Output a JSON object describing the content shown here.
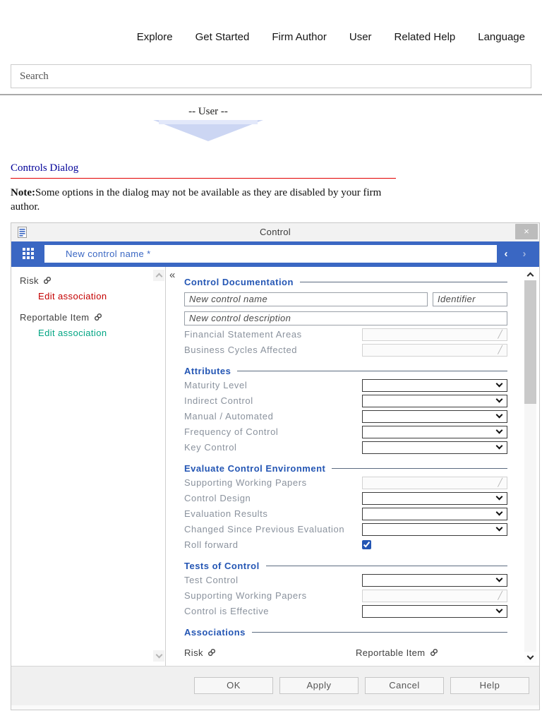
{
  "nav": {
    "items": [
      "Explore",
      "Get Started",
      "Firm Author",
      "User",
      "Related Help",
      "Language"
    ]
  },
  "search": {
    "placeholder": "Search"
  },
  "flow": {
    "user_label": "-- User --"
  },
  "article": {
    "title": "Controls Dialog",
    "note_label": "Note:",
    "note_text": "Some options in the dialog may not be available as they are disabled by your firm author."
  },
  "icons": {
    "close": "×",
    "collapse": "«",
    "prev": "‹",
    "next": "›",
    "edit": "╱"
  },
  "dialog": {
    "title": "Control",
    "toolbar": {
      "name_value": "New control name *"
    },
    "sidebar": {
      "items": [
        {
          "label": "Risk",
          "action": "Edit association"
        },
        {
          "label": "Reportable Item",
          "action": "Edit association"
        }
      ]
    },
    "form": {
      "doc": {
        "title": "Control Documentation",
        "name_placeholder": "New control name",
        "identifier_placeholder": "Identifier",
        "description_placeholder": "New control description",
        "rows": [
          "Financial Statement Areas",
          "Business Cycles Affected"
        ]
      },
      "attributes": {
        "title": "Attributes",
        "rows": [
          "Maturity Level",
          "Indirect Control",
          "Manual / Automated",
          "Frequency of Control",
          "Key Control"
        ]
      },
      "evaluate": {
        "title": "Evaluate Control Environment",
        "disabled_row": "Supporting Working Papers",
        "select_rows": [
          "Control Design",
          "Evaluation Results",
          "Changed Since Previous Evaluation"
        ],
        "checkbox_row": "Roll forward",
        "checkbox_checked": "true"
      },
      "tests": {
        "title": "Tests of Control",
        "select_row_1": "Test Control",
        "disabled_row": "Supporting Working Papers",
        "select_row_2": "Control is Effective"
      },
      "associations": {
        "title": "Associations",
        "items": [
          "Risk",
          "Reportable Item"
        ]
      }
    },
    "footer": {
      "buttons": [
        "OK",
        "Apply",
        "Cancel",
        "Help"
      ]
    }
  },
  "colors": {
    "toolbar_blue": "#3a67c3",
    "heading_blue": "#2456b4",
    "action_red": "#c40000",
    "action_teal": "#00a583",
    "title_underline_red": "#e30000",
    "title_navy": "#000099"
  }
}
